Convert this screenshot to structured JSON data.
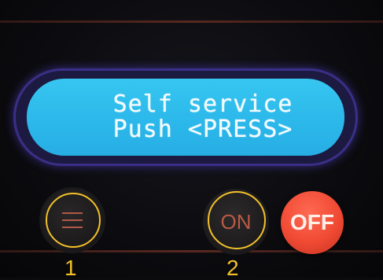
{
  "display": {
    "line1": "Self service",
    "line2": "Push <PRESS>"
  },
  "buttons": {
    "menu_icon": "menu-icon",
    "on_label": "ON",
    "off_label": "OFF"
  },
  "annotations": {
    "marker1": "1",
    "marker2": "2",
    "ring_color": "#f2c12a"
  },
  "colors": {
    "lcd_background": "#2bb7ea",
    "lcd_text": "#f3fbff",
    "off_button": "#f04a34",
    "button_text": "#b85a44"
  }
}
